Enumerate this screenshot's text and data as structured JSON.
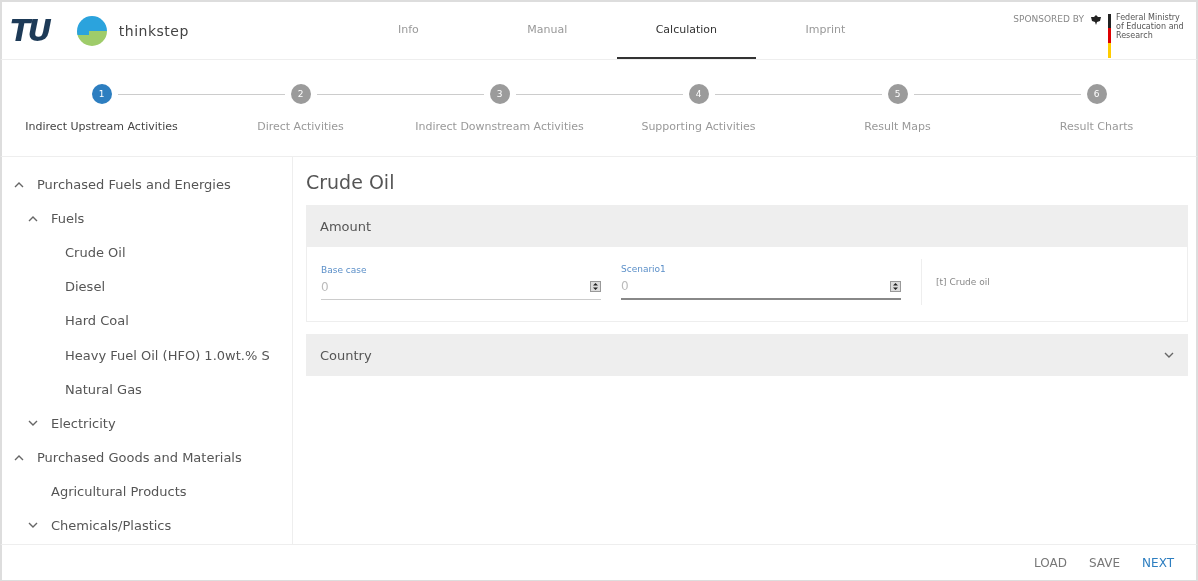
{
  "header": {
    "logo_text": "TU",
    "brand": "thinkstep",
    "nav": [
      {
        "label": "Info",
        "selected": false
      },
      {
        "label": "Manual",
        "selected": false
      },
      {
        "label": "Calculation",
        "selected": true
      },
      {
        "label": "Imprint",
        "selected": false
      }
    ],
    "sponsor": {
      "label": "SPONSORED BY",
      "ministry": "Federal Ministry of Education and Research"
    }
  },
  "steps": [
    {
      "number": "1",
      "label": "Indirect Upstream Activities",
      "selected": true
    },
    {
      "number": "2",
      "label": "Direct Activities",
      "selected": false
    },
    {
      "number": "3",
      "label": "Indirect Downstream Activities",
      "selected": false
    },
    {
      "number": "4",
      "label": "Supporting Activities",
      "selected": false
    },
    {
      "number": "5",
      "label": "Result Maps",
      "selected": false
    },
    {
      "number": "6",
      "label": "Result Charts",
      "selected": false
    }
  ],
  "sidebar": {
    "items": [
      {
        "label": "Purchased Fuels and Energies",
        "expanded": true,
        "children": [
          {
            "label": "Fuels",
            "expanded": true,
            "children": [
              {
                "label": "Crude Oil"
              },
              {
                "label": "Diesel"
              },
              {
                "label": "Hard Coal"
              },
              {
                "label": "Heavy Fuel Oil (HFO) 1.0wt.% S"
              },
              {
                "label": "Natural Gas"
              }
            ]
          },
          {
            "label": "Electricity",
            "expanded": false
          }
        ]
      },
      {
        "label": "Purchased Goods and Materials",
        "expanded": true,
        "children": [
          {
            "label": "Agricultural Products"
          },
          {
            "label": "Chemicals/Plastics",
            "expanded": false
          }
        ]
      }
    ]
  },
  "main": {
    "title": "Crude Oil",
    "amount": {
      "heading": "Amount",
      "fields": [
        {
          "label": "Base case",
          "value": "0",
          "focused": false
        },
        {
          "label": "Scenario1",
          "value": "0",
          "focused": true
        }
      ],
      "unit": "[t] Crude oil"
    },
    "country": {
      "heading": "Country",
      "expanded": false
    }
  },
  "footer": {
    "buttons": [
      {
        "label": "LOAD",
        "kind": "plain"
      },
      {
        "label": "SAVE",
        "kind": "plain"
      },
      {
        "label": "NEXT",
        "kind": "primary"
      }
    ]
  }
}
